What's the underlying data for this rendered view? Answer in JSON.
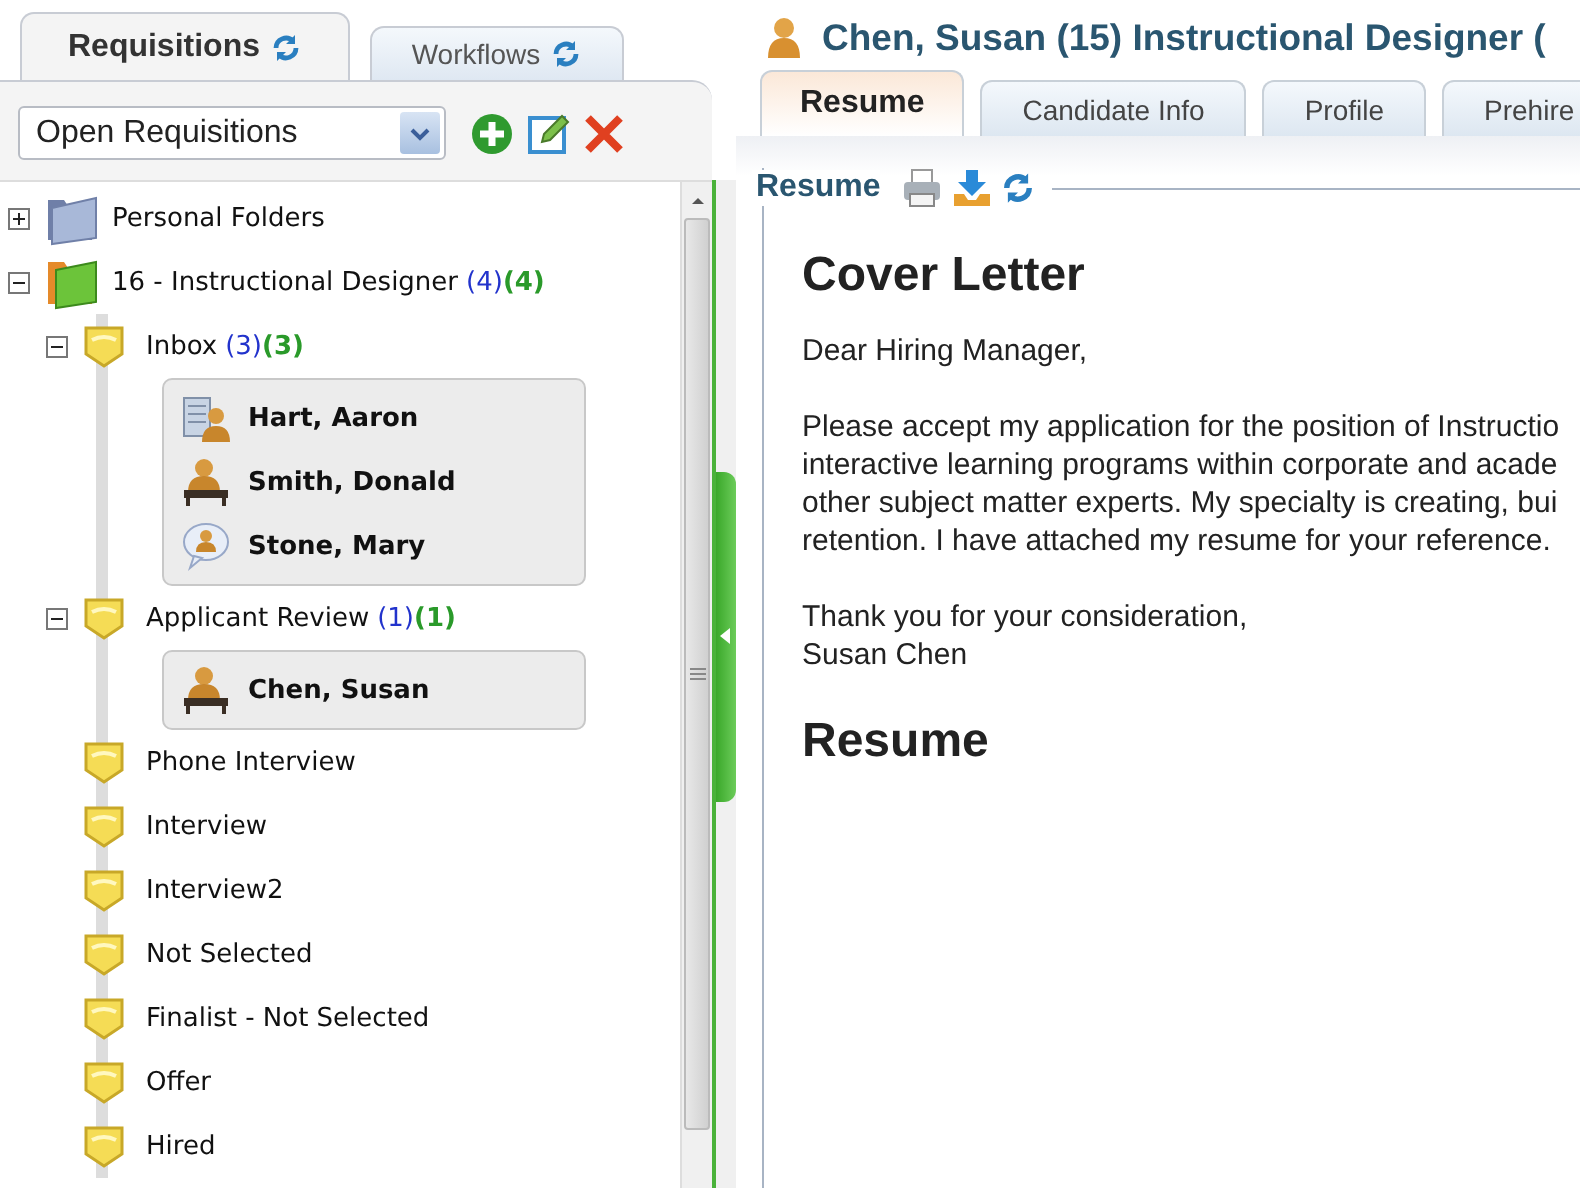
{
  "left_tabs": [
    {
      "label": "Requisitions",
      "selected": true
    },
    {
      "label": "Workflows",
      "selected": false
    }
  ],
  "filter": {
    "value": "Open Requisitions"
  },
  "tree": [
    {
      "label": "Personal Folders",
      "kind": "personal",
      "expanded": false
    },
    {
      "label": "16 - Instructional Designer",
      "count_1": "(4)",
      "count_2": "(4)",
      "kind": "requisition",
      "expanded": true,
      "children": [
        {
          "label": "Inbox",
          "count_1": "(3)",
          "count_2": "(3)",
          "expanded": true,
          "children": [
            {
              "name": "Hart, Aaron",
              "kind": "building"
            },
            {
              "name": "Smith, Donald",
              "kind": "desk"
            },
            {
              "name": "Stone, Mary",
              "kind": "bubble"
            }
          ]
        },
        {
          "label": "Applicant Review",
          "count_1": "(1)",
          "count_2": "(1)",
          "expanded": true,
          "children": [
            {
              "name": "Chen, Susan",
              "kind": "desk"
            }
          ]
        },
        {
          "label": "Phone Interview"
        },
        {
          "label": "Interview"
        },
        {
          "label": "Interview2"
        },
        {
          "label": "Not Selected"
        },
        {
          "label": "Finalist - Not Selected"
        },
        {
          "label": "Offer"
        },
        {
          "label": "Hired"
        }
      ]
    }
  ],
  "candidate": {
    "title": "Chen, Susan (15) Instructional Designer ("
  },
  "tabs": [
    {
      "label": "Resume",
      "selected": true
    },
    {
      "label": "Candidate Info",
      "selected": false
    },
    {
      "label": "Profile",
      "selected": false
    },
    {
      "label": "Prehire",
      "selected": false
    }
  ],
  "section": {
    "legend": "Resume"
  },
  "document": {
    "heading": "Cover Letter",
    "salutation": "Dear Hiring Manager,",
    "body_lines": [
      "Please accept my application for the position of Instructio",
      "interactive learning programs within corporate and acade",
      "other subject matter experts. My specialty is creating, bui",
      "retention. I have attached my resume for your reference."
    ],
    "closing_lines": [
      "Thank you for your consideration,",
      "Susan Chen"
    ],
    "next_heading": "Resume"
  }
}
